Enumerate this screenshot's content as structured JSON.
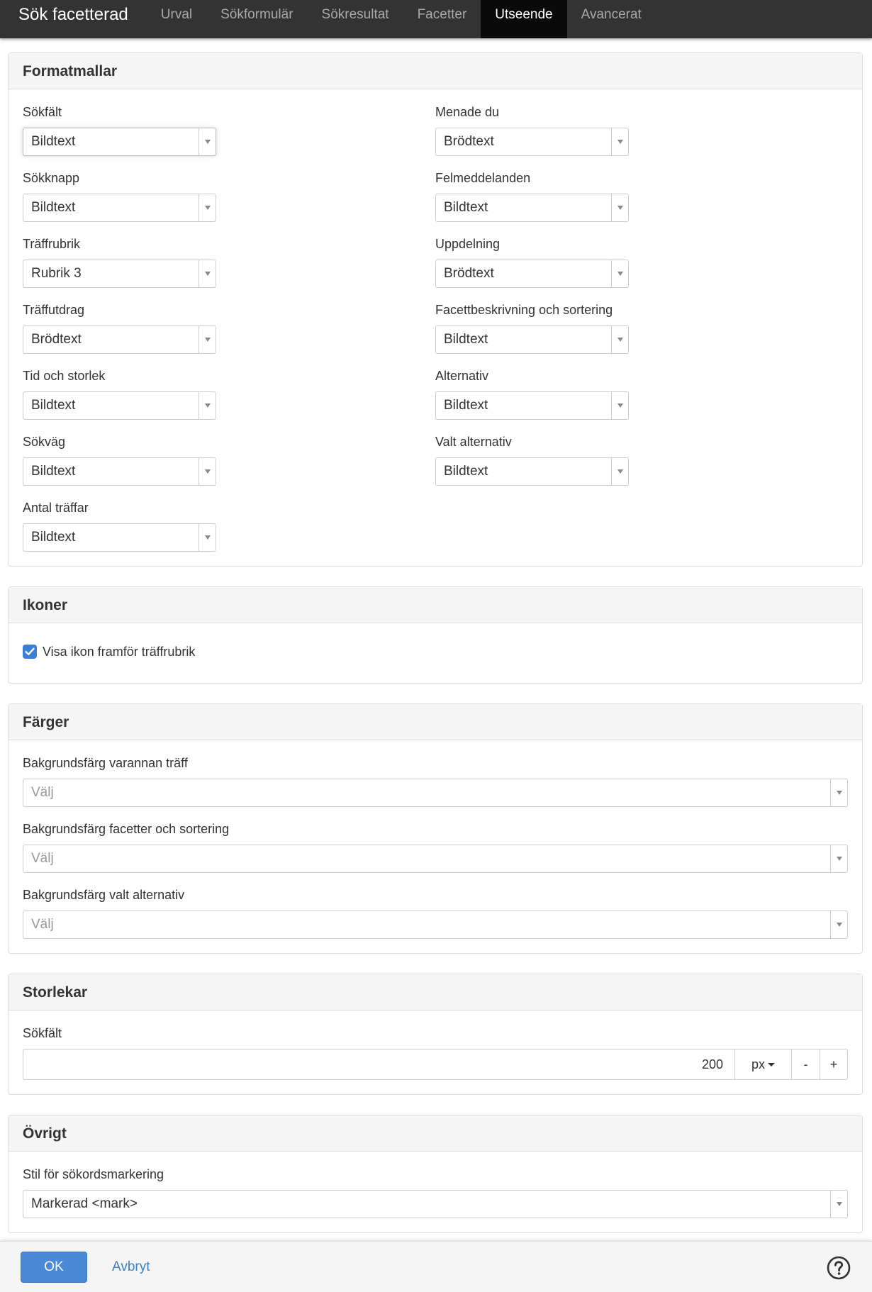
{
  "header": {
    "brand": "Sök facetterad",
    "tabs": [
      {
        "label": "Urval"
      },
      {
        "label": "Sökformulär"
      },
      {
        "label": "Sökresultat"
      },
      {
        "label": "Facetter"
      },
      {
        "label": "Utseende",
        "active": true
      },
      {
        "label": "Avancerat"
      }
    ]
  },
  "formatmallar": {
    "title": "Formatmallar",
    "left": [
      {
        "label": "Sökfält",
        "value": "Bildtext"
      },
      {
        "label": "Sökknapp",
        "value": "Bildtext"
      },
      {
        "label": "Träffrubrik",
        "value": "Rubrik 3"
      },
      {
        "label": "Träffutdrag",
        "value": "Brödtext"
      },
      {
        "label": "Tid och storlek",
        "value": "Bildtext"
      },
      {
        "label": "Sökväg",
        "value": "Bildtext"
      },
      {
        "label": "Antal träffar",
        "value": "Bildtext"
      }
    ],
    "right": [
      {
        "label": "Menade du",
        "value": "Brödtext"
      },
      {
        "label": "Felmeddelanden",
        "value": "Bildtext"
      },
      {
        "label": "Uppdelning",
        "value": "Brödtext"
      },
      {
        "label": "Facettbeskrivning och sortering",
        "value": "Bildtext"
      },
      {
        "label": "Alternativ",
        "value": "Bildtext"
      },
      {
        "label": "Valt alternativ",
        "value": "Bildtext"
      }
    ]
  },
  "ikoner": {
    "title": "Ikoner",
    "checkbox_label": "Visa ikon framför träffrubrik",
    "checked": true
  },
  "farger": {
    "title": "Färger",
    "fields": [
      {
        "label": "Bakgrundsfärg varannan träff",
        "placeholder": "Välj"
      },
      {
        "label": "Bakgrundsfärg facetter och sortering",
        "placeholder": "Välj"
      },
      {
        "label": "Bakgrundsfärg valt alternativ",
        "placeholder": "Välj"
      }
    ]
  },
  "storlekar": {
    "title": "Storlekar",
    "field_label": "Sökfält",
    "value": "200",
    "unit": "px",
    "minus": "-",
    "plus": "+"
  },
  "ovrigt": {
    "title": "Övrigt",
    "field_label": "Stil för sökordsmarkering",
    "value": "Markerad <mark>"
  },
  "footer": {
    "ok_label": "OK",
    "cancel_label": "Avbryt"
  },
  "colors": {
    "topbar": "#333333",
    "active_tab": "#0a0a0a",
    "primary": "#4a8ad4",
    "link": "#3b7fc4",
    "checkbox": "#3a7fd4"
  }
}
